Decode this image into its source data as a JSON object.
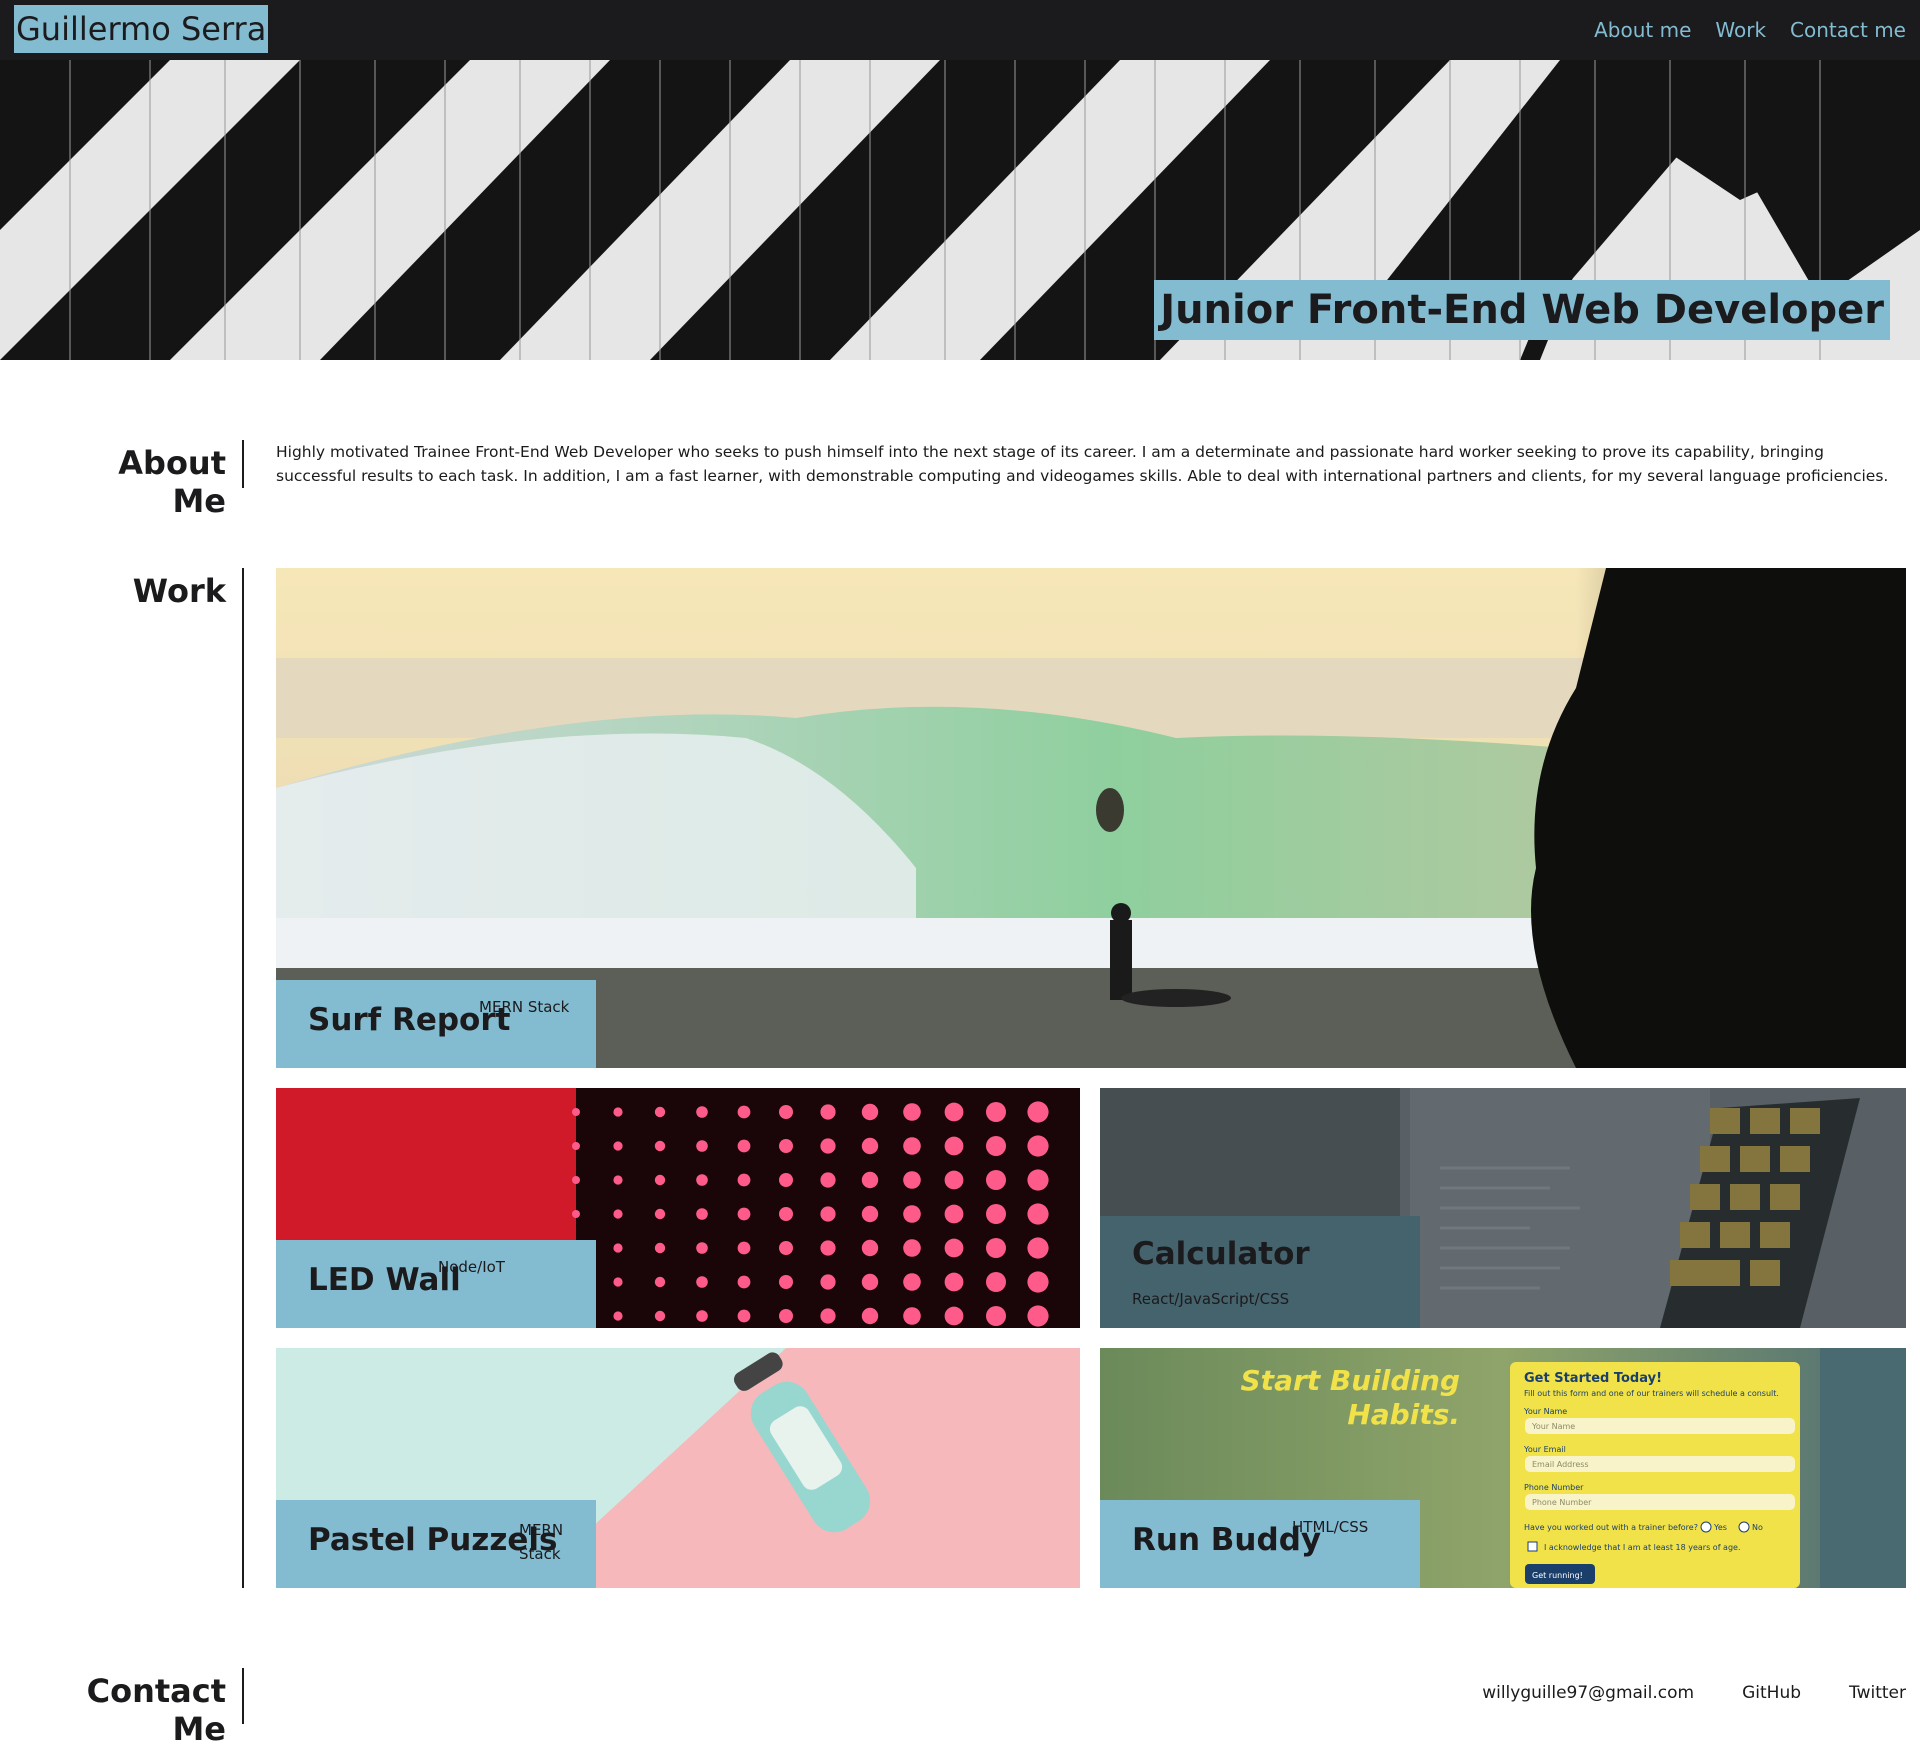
{
  "header": {
    "brand": "Guillermo Serra",
    "nav": [
      {
        "label": "About me"
      },
      {
        "label": "Work"
      },
      {
        "label": "Contact me"
      }
    ]
  },
  "hero": {
    "title": "Junior Front-End Web Developer"
  },
  "about": {
    "heading": "About Me",
    "text": "Highly motivated Trainee Front-End Web Developer who seeks to push himself into the next stage of its career. I am a determinate and passionate hard worker seeking to prove its capability, bringing successful results to each task. In addition, I am a fast learner, with demonstrable computing and videogames skills. Able to deal with international partners and clients, for my several language proficiencies."
  },
  "work": {
    "heading": "Work",
    "projects": [
      {
        "title": "Surf Report",
        "stack": "MERN Stack"
      },
      {
        "title": "LED Wall",
        "stack": "Node/IoT"
      },
      {
        "title": "Calculator",
        "stack": "React/JavaScript/CSS"
      },
      {
        "title": "Pastel Puzzels",
        "stack": "MERN Stack"
      },
      {
        "title": "Run Buddy",
        "stack": "HTML/CSS"
      }
    ],
    "runbuddy_preview": {
      "headline1": "Start Building",
      "headline2": "Habits.",
      "form_title": "Get Started Today!",
      "form_sub": "Fill out this form and one of our trainers will schedule a consult.",
      "name_label": "Your Name",
      "name_ph": "Your Name",
      "email_label": "Your Email",
      "email_ph": "Email Address",
      "phone_label": "Phone Number",
      "phone_ph": "Phone Number",
      "question": "Have you worked out with a trainer before?",
      "yes": "Yes",
      "no": "No",
      "ack": "I acknowledge that I am at least 18 years of age.",
      "button": "Get running!"
    }
  },
  "contact": {
    "heading": "Contact Me",
    "links": [
      {
        "label": "willyguille97@gmail.com"
      },
      {
        "label": "GitHub"
      },
      {
        "label": "Twitter"
      }
    ]
  },
  "colors": {
    "accent": "#83bbd0",
    "dark": "#1b1a1c",
    "calculator_label": "#45636d"
  }
}
